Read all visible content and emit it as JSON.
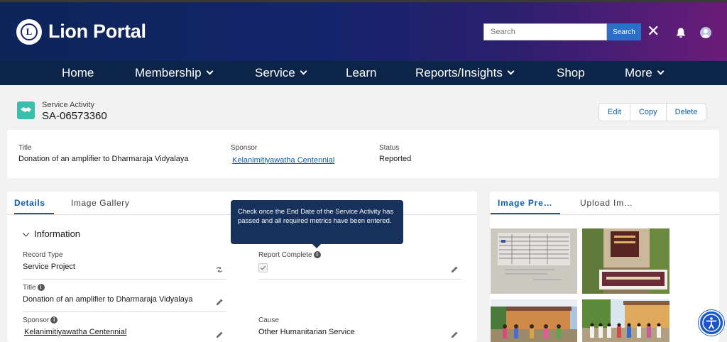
{
  "header": {
    "brand": "Lion Portal",
    "search_placeholder": "Search",
    "search_button": "Search",
    "close_glyph": "✕",
    "logo_letter": "L"
  },
  "nav": {
    "items": [
      {
        "label": "Home"
      },
      {
        "label": "Membership"
      },
      {
        "label": "Service"
      },
      {
        "label": "Learn"
      },
      {
        "label": "Reports/Insights"
      },
      {
        "label": "Shop"
      },
      {
        "label": "More"
      }
    ]
  },
  "record": {
    "type": "Service Activity",
    "name": "SA-06573360",
    "actions": [
      "Edit",
      "Copy",
      "Delete"
    ]
  },
  "highlights": {
    "title_label": "Title",
    "title_value": "Donation of an amplifier to Dharmaraja Vidyalaya",
    "sponsor_label": "Sponsor",
    "sponsor_value": "Kelanimitiyawatha Centennial",
    "status_label": "Status",
    "status_value": "Reported"
  },
  "main": {
    "tabs": [
      "Details",
      "Image Gallery"
    ],
    "section": "Information",
    "fields": {
      "record_type_label": "Record Type",
      "record_type_value": "Service Project",
      "report_complete_label": "Report Complete",
      "title_label": "Title",
      "title_value": "Donation of an amplifier to Dharmaraja Vidyalaya",
      "sponsor_label": "Sponsor",
      "sponsor_value": "Kelanimitiyawatha Centennial",
      "cause_label": "Cause",
      "cause_value": "Other Humanitarian Service"
    },
    "tooltip": "Check once the End Date of the Service Activity has passed and all required metrics have been entered."
  },
  "side": {
    "tabs": [
      "Image Pre…",
      "Upload Im…"
    ]
  },
  "colors": {
    "accent": "#0b5cab",
    "nav_bg": "#0b2447",
    "record_icon": "#3bbfad"
  }
}
